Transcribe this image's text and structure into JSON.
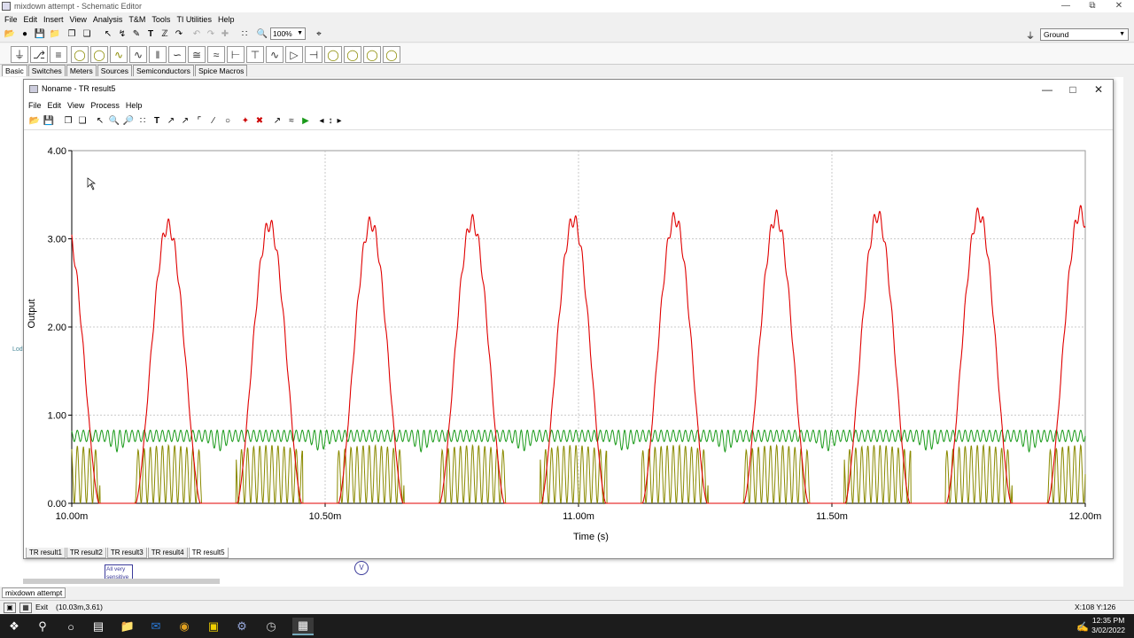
{
  "app": {
    "title": "mixdown attempt - Schematic Editor",
    "menu": [
      "File",
      "Edit",
      "Insert",
      "View",
      "Analysis",
      "T&M",
      "Tools",
      "TI Utilities",
      "Help"
    ],
    "zoom": "100%",
    "ground_select": "Ground",
    "component_tabs": [
      "Basic",
      "Switches",
      "Meters",
      "Sources",
      "Semiconductors",
      "Spice Macros"
    ],
    "active_component_tab": "Basic",
    "doc_tab": "mixdown attempt",
    "status_coords": "(10.03m,3.61)",
    "status_xy": "X:108 Y:126",
    "exit_label": "Exit"
  },
  "result_window": {
    "title": "Noname - TR result5",
    "menu": [
      "File",
      "Edit",
      "View",
      "Process",
      "Help"
    ],
    "tabs": [
      "TR result1",
      "TR result2",
      "TR result3",
      "TR result4",
      "TR result5"
    ],
    "active_tab": "TR result5"
  },
  "schematic_labels": {
    "label1": "All very",
    "label2": "sensitive",
    "label3": "Lod"
  },
  "chart_data": {
    "type": "line",
    "xlabel": "Time (s)",
    "ylabel": "Output",
    "xlim": [
      0.01,
      0.012
    ],
    "ylim": [
      0,
      4
    ],
    "x_ticks": [
      "10.00m",
      "10.50m",
      "11.00m",
      "11.50m",
      "12.00m"
    ],
    "y_ticks": [
      "0.00",
      "1.00",
      "2.00",
      "3.00",
      "4.00"
    ],
    "grid": true,
    "series": [
      {
        "color": "#e00000",
        "kind": "rectified-sine-with-ripple",
        "peak_start": 3.13,
        "peak_end": 3.3,
        "period": 0.0002,
        "first_peak": 0.01019,
        "ripple": 0.08
      },
      {
        "color": "#1a9a1a",
        "kind": "ripple-band",
        "upper": 0.83,
        "lower": 0.7,
        "dip_low": 0.58
      },
      {
        "color": "#8a8a00",
        "kind": "pulsed-burst",
        "upper": 0.66,
        "lower": 0.0
      }
    ]
  },
  "clock": {
    "time": "12:35 PM",
    "date": "3/02/2022"
  },
  "icons": {
    "search": "search-icon",
    "start": "windows-start-icon",
    "task_view": "task-view-icon"
  }
}
